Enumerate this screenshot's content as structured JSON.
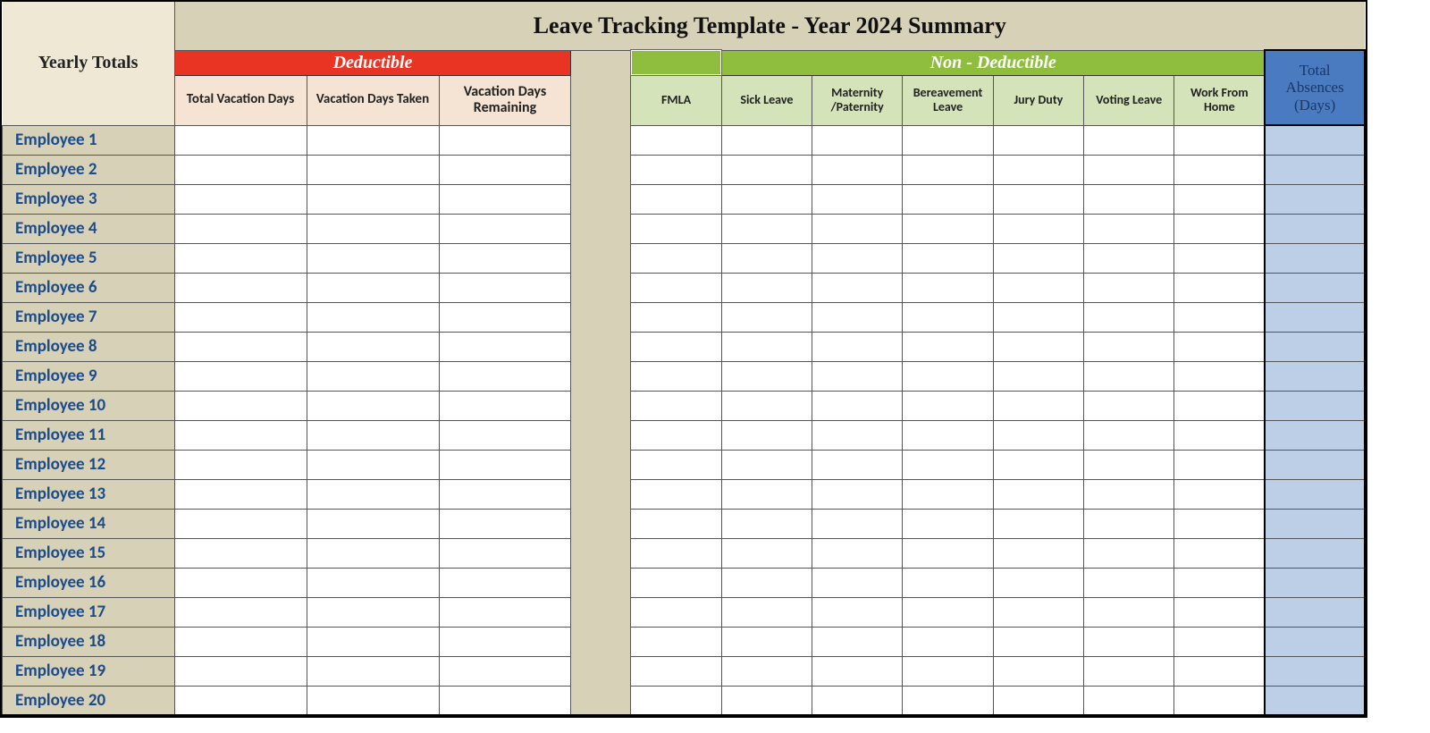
{
  "corner_label": "Yearly Totals",
  "title": "Leave Tracking Template - Year 2024 Summary",
  "deductible": {
    "header": "Deductible",
    "columns": [
      "Total Vacation Days",
      "Vacation Days Taken",
      "Vacation Days Remaining"
    ]
  },
  "non_deductible": {
    "header": "Non - Deductible",
    "columns": [
      "FMLA",
      "Sick Leave",
      "Maternity /Paternity",
      "Bereavement Leave",
      "Jury Duty",
      "Voting Leave",
      "Work From Home"
    ]
  },
  "total_label_line1": "Total",
  "total_label_line2": "Absences",
  "total_label_line3": "(Days)",
  "employees": [
    "Employee 1",
    "Employee 2",
    "Employee 3",
    "Employee 4",
    "Employee 5",
    "Employee 6",
    "Employee 7",
    "Employee 8",
    "Employee 9",
    "Employee 10",
    "Employee 11",
    "Employee 12",
    "Employee 13",
    "Employee 14",
    "Employee 15",
    "Employee 16",
    "Employee 17",
    "Employee 18",
    "Employee 19",
    "Employee 20"
  ]
}
